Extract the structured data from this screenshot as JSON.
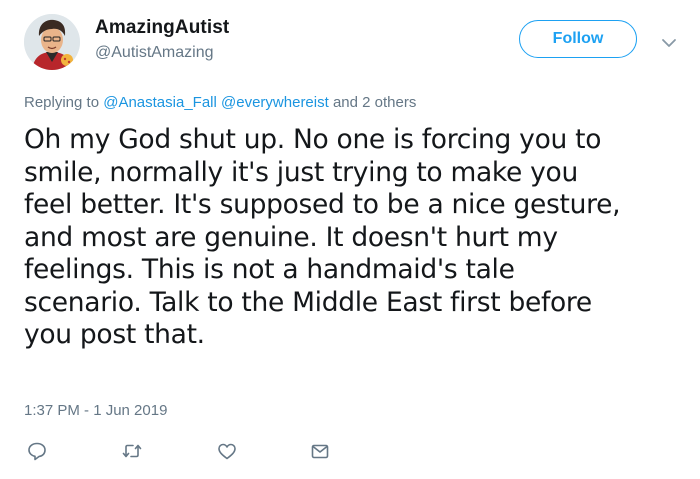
{
  "user": {
    "display_name": "AmazingAutist",
    "handle": "@AutistAmazing",
    "avatar_icon": "cartoon-avatar"
  },
  "header": {
    "follow_label": "Follow",
    "menu_icon": "chevron-down-icon"
  },
  "reply": {
    "prefix": "Replying to",
    "mentions": [
      "@Anastasia_Fall",
      "@everywhereist"
    ],
    "suffix": "and 2 others"
  },
  "tweet": {
    "text": "Oh my God shut up. No one is forcing you to\nsmile, normally it's just trying to make you\nfeel better. It's supposed to be a nice gesture,\nand most are genuine. It doesn't hurt my\nfeelings. This is not a handmaid's tale\nscenario. Talk to the Middle East first before\nyou post that.",
    "timestamp": "1:37 PM - 1 Jun 2019"
  },
  "actions": {
    "icons": [
      "reply-icon",
      "retweet-icon",
      "like-icon",
      "message-icon"
    ]
  },
  "colors": {
    "accent": "#1da1f2",
    "link": "#1b95e0",
    "muted": "#657786",
    "text": "#14171a"
  }
}
